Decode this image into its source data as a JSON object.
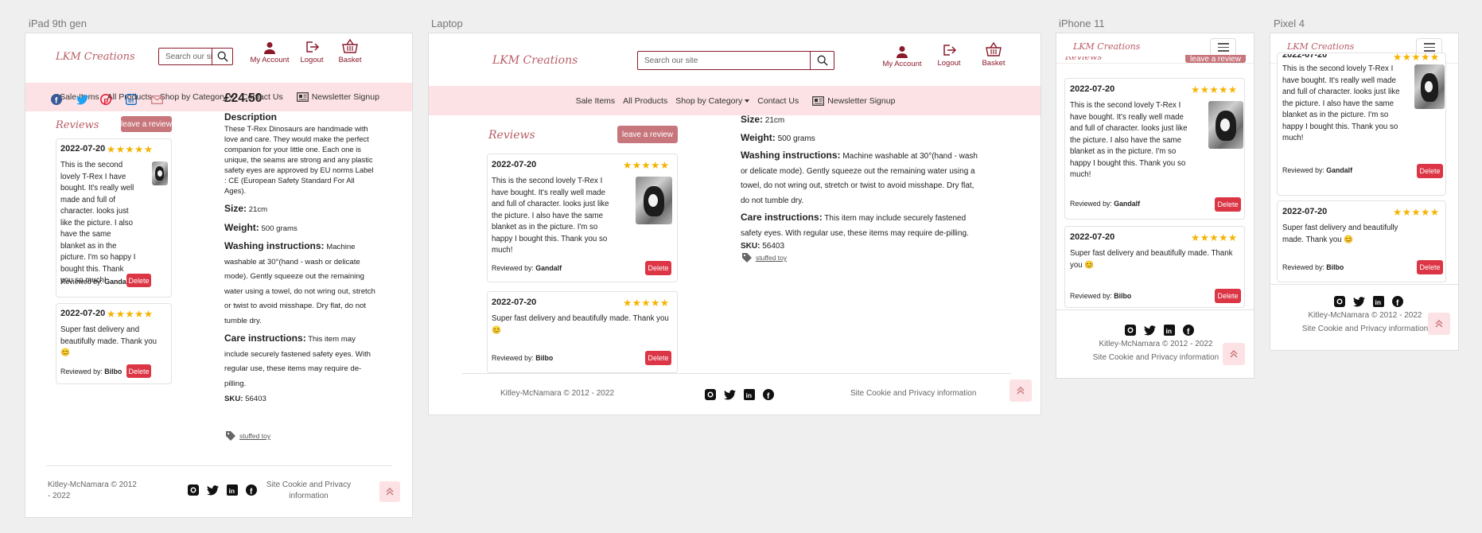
{
  "devices": {
    "ipad": "iPad 9th gen",
    "laptop": "Laptop",
    "iphone": "iPhone 11",
    "pixel": "Pixel 4"
  },
  "brand": "LKM Creations",
  "search": {
    "placeholder_short": "Search our site",
    "placeholder": "Search our site"
  },
  "nav": {
    "account": "My Account",
    "logout": "Logout",
    "basket": "Basket"
  },
  "menu": {
    "sale": "Sale Items",
    "all": "All Products",
    "category": "Shop by Category",
    "contact": "Contact Us",
    "newsletter": "Newsletter Signup"
  },
  "reviews": {
    "heading": "Reviews",
    "leave": "leave a review",
    "reviewed_by": "Reviewed by:",
    "delete": "Delete",
    "stars": "★★★★★",
    "items": [
      {
        "date": "2022-07-20",
        "text": "This is the second lovely T-Rex I have bought. It's really well made and full of character. looks just like the picture. I also have the same blanket as in the picture. I'm so happy I bought this. Thank you so much!",
        "author": "Gandalf",
        "rating": 5
      },
      {
        "date": "2022-07-20",
        "text": "Super fast delivery and beautifully made. Thank you 😊",
        "author": "Bilbo",
        "rating": 5
      }
    ]
  },
  "product": {
    "price": "£24.50",
    "desc_label": "Description",
    "desc": "These T-Rex Dinosaurs are handmade with love and care. They would make the perfect companion for your little one. Each one is unique, the seams are strong and any plastic safety eyes are approved by EU norms Label : CE (European Safety Standard For All Ages).",
    "size_label": "Size:",
    "size": "21cm",
    "weight_label": "Weight:",
    "weight": "500 grams",
    "washing_label": "Washing instructions:",
    "washing": "Machine washable at 30°(hand - wash or delicate mode). Gently squeeze out the remaining water using a towel, do not wring out, stretch or twist to avoid misshape. Dry flat, do not tumble dry.",
    "care_label": "Care instructions:",
    "care": "This item may include securely fastened safety eyes. With regular use, these items may require de-pilling.",
    "sku_label": "SKU:",
    "sku": "56403",
    "tag": "stuffed toy"
  },
  "footer": {
    "copyright": "Kitley-McNamara © 2012 - 2022",
    "privacy": "Site Cookie and Privacy information"
  },
  "colors": {
    "brand": "#b85c66",
    "maroon": "#8a1a2a",
    "pink_bar": "#fce2e4",
    "star": "#f5b301",
    "delete": "#dc3545"
  }
}
